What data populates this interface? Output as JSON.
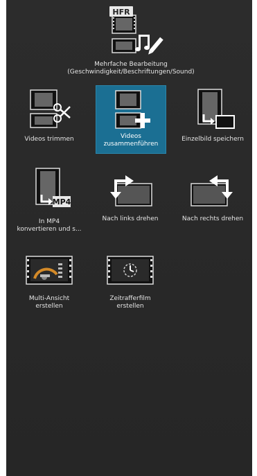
{
  "tools": {
    "multi_edit": {
      "badge": "HFR",
      "line1": "Mehrfache Bearbeitung",
      "line2": "(Geschwindigkeit/Beschriftungen/Sound)"
    },
    "trim": {
      "label": "Videos trimmen"
    },
    "merge": {
      "line1": "Videos",
      "line2": "zusammenführen"
    },
    "frame": {
      "label": "Einzelbild speichern"
    },
    "mp4": {
      "badge": "MP4",
      "line1": "In MP4",
      "line2": "konvertieren und s..."
    },
    "rotate_left": {
      "label": "Nach links drehen"
    },
    "rotate_right": {
      "label": "Nach rechts drehen"
    },
    "multiview": {
      "line1": "Multi-Ansicht",
      "line2": "erstellen"
    },
    "timelapse": {
      "line1": "Zeitrafferfilm",
      "line2": "erstellen"
    }
  },
  "colors": {
    "panel_bg": "#2b2b2b",
    "selected_bg": "#1b6f93",
    "icon_white": "#ffffff",
    "text": "#e6e6e6"
  }
}
